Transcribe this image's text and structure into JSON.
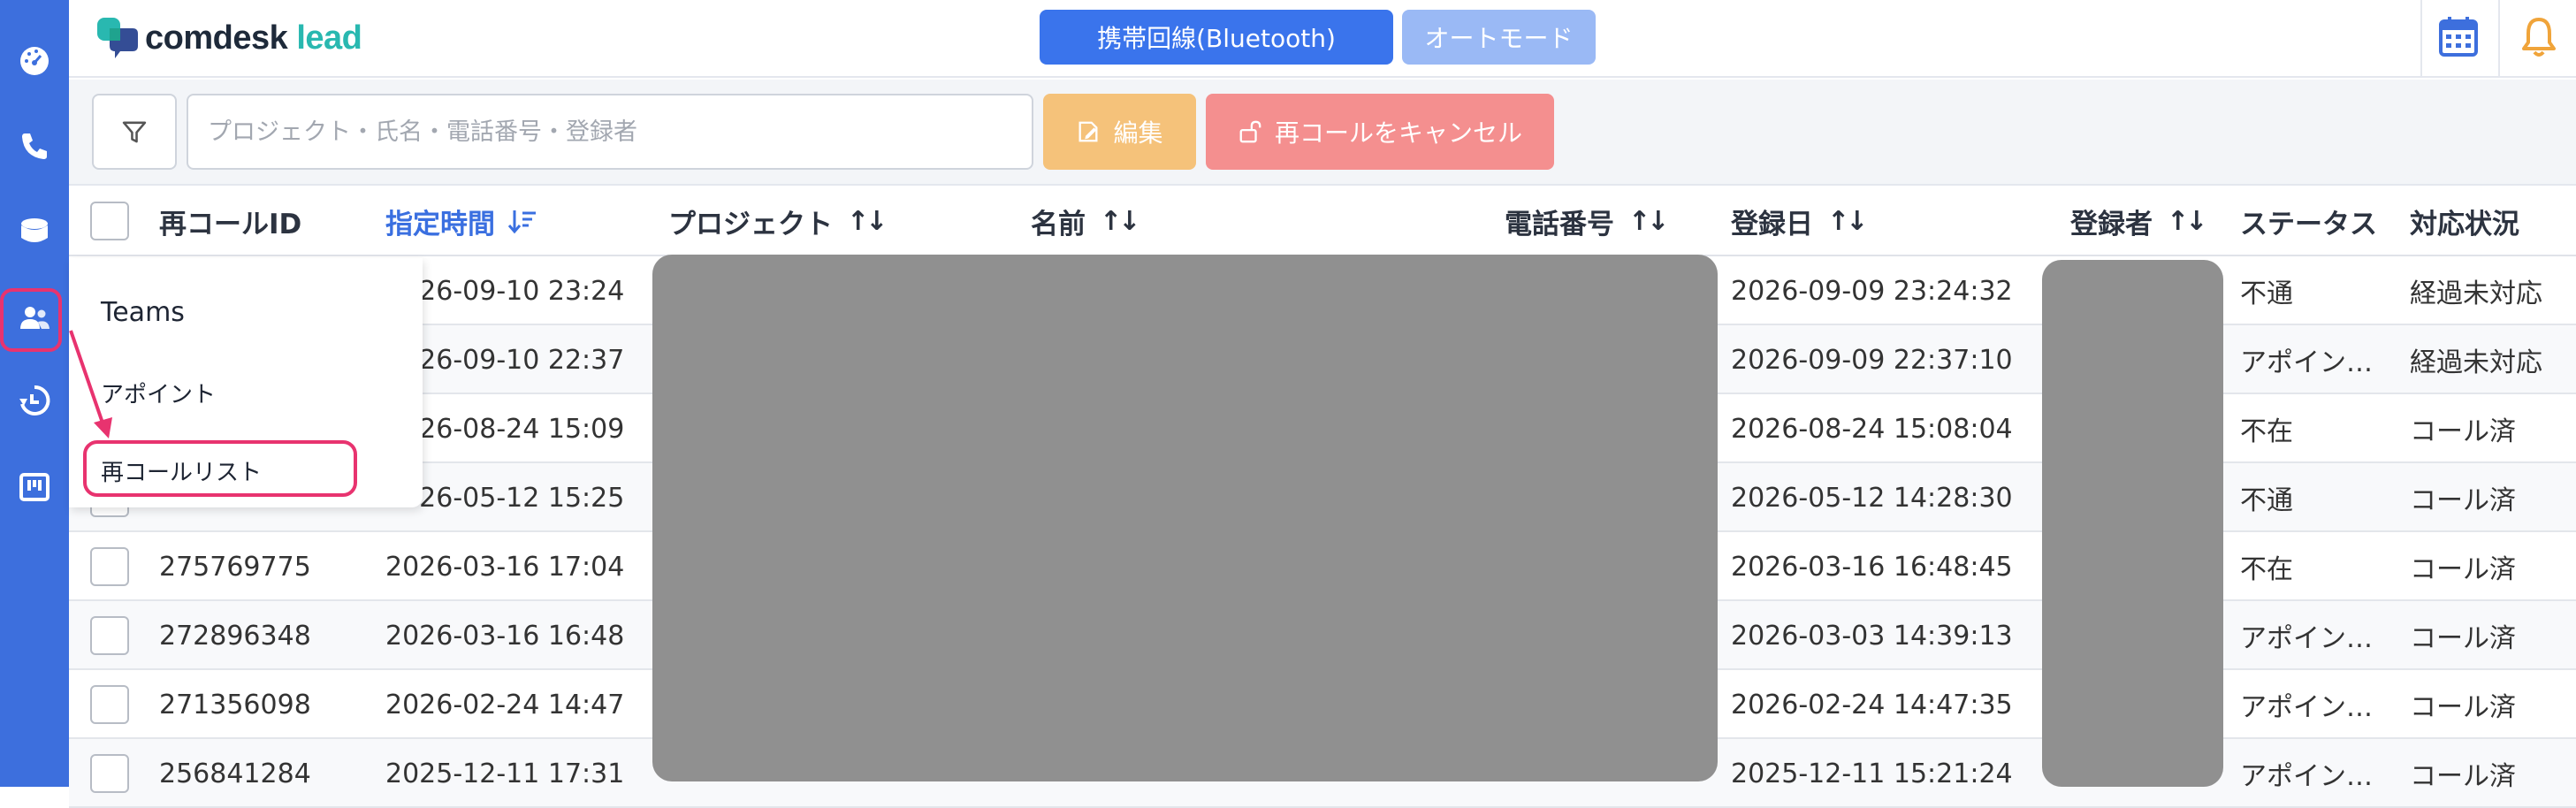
{
  "header": {
    "logo_text_main": "comdesk",
    "logo_text_accent": "lead",
    "primary_button": "携帯回線(Bluetooth)",
    "auto_button": "オートモード"
  },
  "toolbar": {
    "search_placeholder": "プロジェクト・氏名・電話番号・登録者",
    "edit_label": "編集",
    "cancel_label": "再コールをキャンセル"
  },
  "table": {
    "columns": {
      "id": "再コールID",
      "time": "指定時間",
      "project": "プロジェクト",
      "name": "名前",
      "phone": "電話番号",
      "registered": "登録日",
      "registrant": "登録者",
      "status": "ステータス",
      "progress": "対応状況"
    },
    "rows": [
      {
        "id": "",
        "time": "2026-09-10 23:24",
        "registered": "2026-09-09 23:24:32",
        "status": "不通",
        "progress": "経過未対応"
      },
      {
        "id": "",
        "time": "2026-09-10 22:37",
        "registered": "2026-09-09 22:37:10",
        "status": "アポイン…",
        "progress": "経過未対応"
      },
      {
        "id": "",
        "time": "2026-08-24 15:09",
        "registered": "2026-08-24 15:08:04",
        "status": "不在",
        "progress": "コール済"
      },
      {
        "id": "",
        "time": "2026-05-12 15:25",
        "registered": "2026-05-12 14:28:30",
        "status": "不通",
        "progress": "コール済"
      },
      {
        "id": "275769775",
        "time": "2026-03-16 17:04",
        "registered": "2026-03-16 16:48:45",
        "status": "不在",
        "progress": "コール済"
      },
      {
        "id": "272896348",
        "time": "2026-03-16 16:48",
        "registered": "2026-03-03 14:39:13",
        "status": "アポイン…",
        "progress": "コール済"
      },
      {
        "id": "271356098",
        "time": "2026-02-24 14:47",
        "registered": "2026-02-24 14:47:35",
        "status": "アポイン…",
        "progress": "コール済"
      },
      {
        "id": "256841284",
        "time": "2025-12-11 17:31",
        "registered": "2025-12-11 15:21:24",
        "status": "アポイン…",
        "progress": "コール済"
      }
    ]
  },
  "menu": {
    "items": [
      "Teams",
      "アポイント",
      "再コールリスト"
    ]
  },
  "colors": {
    "rail": "#3d6fdd",
    "primary": "#3a74ec",
    "highlight": "#e8336f",
    "edit": "#f5c27a",
    "cancel": "#f48f8f"
  },
  "icons": [
    "dashboard-icon",
    "phone-icon",
    "database-icon",
    "users-icon",
    "history-icon",
    "board-icon",
    "filter-icon",
    "calendar-icon",
    "bell-icon",
    "edit-icon",
    "unlock-icon"
  ]
}
